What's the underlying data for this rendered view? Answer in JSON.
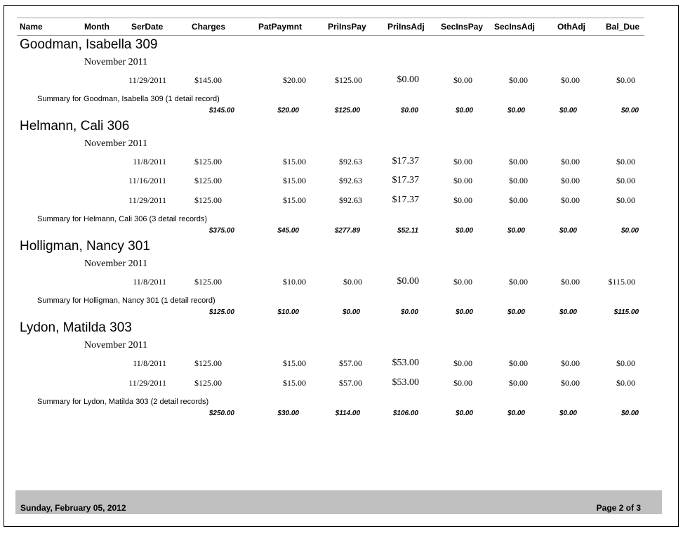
{
  "columns": {
    "name": "Name",
    "month": "Month",
    "serdate": "SerDate",
    "charges": "Charges",
    "patpaymnt": "PatPaymnt",
    "prinspay": "PriInsPay",
    "prinsadj": "PriInsAdj",
    "secinspay": "SecInsPay",
    "secinsadj": "SecInsAdj",
    "othadj": "OthAdj",
    "baldue": "Bal_Due"
  },
  "groups": [
    {
      "name": "Goodman, Isabella 309",
      "month": "November 2011",
      "rows": [
        [
          "11/29/2011",
          "$145.00",
          "$20.00",
          "$125.00",
          "$0.00",
          "$0.00",
          "$0.00",
          "$0.00",
          "$0.00"
        ]
      ],
      "summary": "Summary for  Goodman, Isabella 309 (1 detail record)",
      "totals": [
        "$145.00",
        "$20.00",
        "$125.00",
        "$0.00",
        "$0.00",
        "$0.00",
        "$0.00",
        "$0.00"
      ]
    },
    {
      "name": "Helmann, Cali 306",
      "month": "November 2011",
      "rows": [
        [
          "11/8/2011",
          "$125.00",
          "$15.00",
          "$92.63",
          "$17.37",
          "$0.00",
          "$0.00",
          "$0.00",
          "$0.00"
        ],
        [
          "11/16/2011",
          "$125.00",
          "$15.00",
          "$92.63",
          "$17.37",
          "$0.00",
          "$0.00",
          "$0.00",
          "$0.00"
        ],
        [
          "11/29/2011",
          "$125.00",
          "$15.00",
          "$92.63",
          "$17.37",
          "$0.00",
          "$0.00",
          "$0.00",
          "$0.00"
        ]
      ],
      "summary": "Summary for  Helmann, Cali 306 (3 detail records)",
      "totals": [
        "$375.00",
        "$45.00",
        "$277.89",
        "$52.11",
        "$0.00",
        "$0.00",
        "$0.00",
        "$0.00"
      ]
    },
    {
      "name": "Holligman, Nancy 301",
      "month": "November 2011",
      "rows": [
        [
          "11/8/2011",
          "$125.00",
          "$10.00",
          "$0.00",
          "$0.00",
          "$0.00",
          "$0.00",
          "$0.00",
          "$115.00"
        ]
      ],
      "summary": "Summary for  Holligman, Nancy 301 (1 detail record)",
      "totals": [
        "$125.00",
        "$10.00",
        "$0.00",
        "$0.00",
        "$0.00",
        "$0.00",
        "$0.00",
        "$115.00"
      ]
    },
    {
      "name": "Lydon, Matilda 303",
      "month": "November 2011",
      "rows": [
        [
          "11/8/2011",
          "$125.00",
          "$15.00",
          "$57.00",
          "$53.00",
          "$0.00",
          "$0.00",
          "$0.00",
          "$0.00"
        ],
        [
          "11/29/2011",
          "$125.00",
          "$15.00",
          "$57.00",
          "$53.00",
          "$0.00",
          "$0.00",
          "$0.00",
          "$0.00"
        ]
      ],
      "summary": "Summary for  Lydon, Matilda 303 (2 detail records)",
      "totals": [
        "$250.00",
        "$30.00",
        "$114.00",
        "$106.00",
        "$0.00",
        "$0.00",
        "$0.00",
        "$0.00"
      ]
    }
  ],
  "footer": {
    "date": "Sunday, February 05, 2012",
    "page": "Page 2 of 3"
  },
  "colors": {
    "footer_bar": "#c0c0c0",
    "header_rule": "#9a9a9a"
  }
}
